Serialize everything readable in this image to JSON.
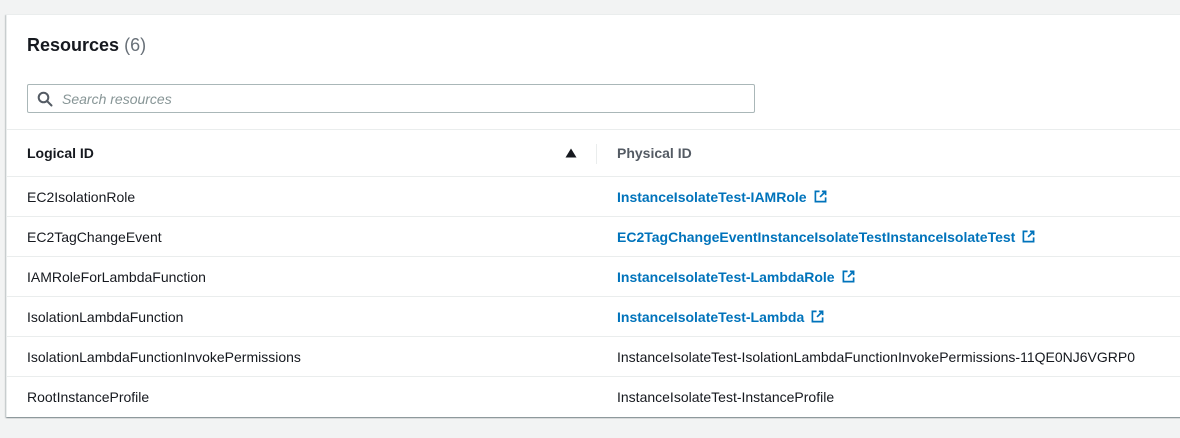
{
  "resources": {
    "title": "Resources",
    "count": "(6)",
    "search": {
      "placeholder": "Search resources",
      "value": ""
    },
    "columns": {
      "logical_id": "Logical ID",
      "physical_id": "Physical ID"
    },
    "sort": {
      "column": "Logical ID",
      "direction": "ascending"
    },
    "rows": [
      {
        "logical_id": "EC2IsolationRole",
        "physical_id": "InstanceIsolateTest-IAMRole",
        "is_link": true
      },
      {
        "logical_id": "EC2TagChangeEvent",
        "physical_id": "EC2TagChangeEventInstanceIsolateTestInstanceIsolateTest",
        "is_link": true
      },
      {
        "logical_id": "IAMRoleForLambdaFunction",
        "physical_id": "InstanceIsolateTest-LambdaRole",
        "is_link": true
      },
      {
        "logical_id": "IsolationLambdaFunction",
        "physical_id": "InstanceIsolateTest-Lambda",
        "is_link": true
      },
      {
        "logical_id": "IsolationLambdaFunctionInvokePermissions",
        "physical_id": "InstanceIsolateTest-IsolationLambdaFunctionInvokePermissions-11QE0NJ6VGRP0",
        "is_link": false
      },
      {
        "logical_id": "RootInstanceProfile",
        "physical_id": "InstanceIsolateTest-InstanceProfile",
        "is_link": false
      }
    ]
  },
  "icons": {
    "search": "search-icon",
    "sort": "caret-up-icon",
    "external_link": "external-link-icon"
  },
  "colors": {
    "link": "#0073bb",
    "text": "#16191f",
    "muted": "#687078",
    "border": "#eaeded",
    "background": "#f2f3f3"
  }
}
